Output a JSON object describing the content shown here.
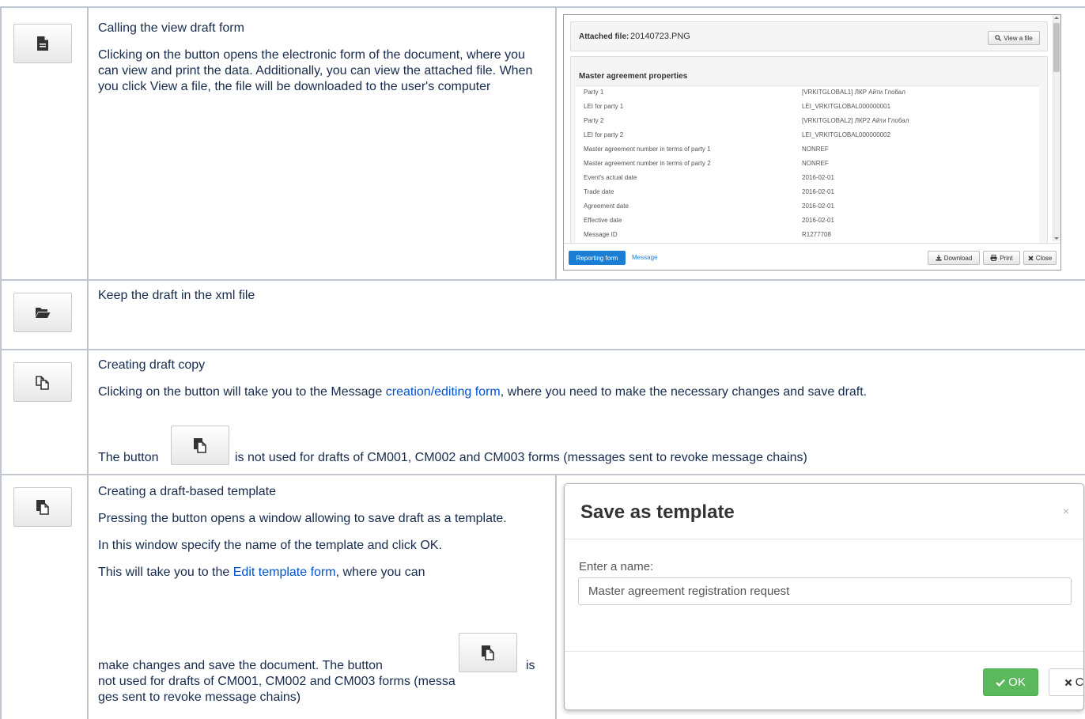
{
  "rows": [
    {
      "icon": "document-icon",
      "title": "Calling the view draft form",
      "body": "Clicking on the button opens the electronic form of the document, where you can view and print the data. Additionally, you can view the attached file. When you click View a file, the file will be downloaded to the user's computer"
    },
    {
      "icon": "folder-open-icon",
      "title": "Keep the draft in the xml file"
    },
    {
      "icon": "copy-icon",
      "title": "Creating draft copy",
      "body_prefix": "Clicking on the button will take you to the M",
      "body_prefix2": "essage ",
      "body_link": "creation/editing form",
      "body_suffix": ", where you need to make the necessary changes and save draft.",
      "note_prefix": "The button",
      "note_suffix": "is not used for drafts of CM001, CM002 and CM003 forms (",
      "note_suffix2": "messages",
      "note_suffix3": " sent to revoke message chains)"
    },
    {
      "icon": "paste-template-icon",
      "title": "Creating a draft-based template",
      "p1": "Pressing the button opens a window allowing to save draft as a template.",
      "p2": "In this window specify the name of the template and click OK.",
      "p3_prefix": "This will take you to the ",
      "p3_link": "Edit template form",
      "p3_suffix": ", where you can",
      "p4_prefix": "make changes and save the document. The button",
      "p4_is": "is",
      "p5": "not used for drafts of CM001, CM002 and CM003 forms (messa",
      "p6": "ges sent to revoke message chains)"
    }
  ],
  "view_form": {
    "attached_label": "Attached file:",
    "attached_value": "20140723.PNG",
    "view_file_btn": "View a file",
    "section_title": "Master agreement properties",
    "properties": [
      {
        "k": "Party 1",
        "v": "[VRKITGLOBAL1] ЛКР Айти Глобал"
      },
      {
        "k": "LEI for party 1",
        "v": "LEI_VRKITGLOBAL000000001"
      },
      {
        "k": "Party 2",
        "v": "[VRKITGLOBAL2] ЛКР2 Айти Глобал"
      },
      {
        "k": "LEI for party 2",
        "v": "LEI_VRKITGLOBAL000000002"
      },
      {
        "k": "Master agreement number in terms of party 1",
        "v": "NONREF"
      },
      {
        "k": "Master agreement number in terms of party 2",
        "v": "NONREF"
      },
      {
        "k": "Event's actual date",
        "v": "2016-02-01"
      },
      {
        "k": "Trade date",
        "v": "2016-02-01"
      },
      {
        "k": "Agreement date",
        "v": "2016-02-01"
      },
      {
        "k": "Effective date",
        "v": "2016-02-01"
      },
      {
        "k": "Message ID",
        "v": "R1277708"
      }
    ],
    "tab_reporting": "Reporting form",
    "tab_message": "Message",
    "download_btn": "Download",
    "print_btn": "Print",
    "close_btn": "Close"
  },
  "template_dialog": {
    "title": "Save as template",
    "close_glyph": "×",
    "label": "Enter a name:",
    "input_value": "Master agreement registration request",
    "ok": "OK",
    "cancel": "Cancel"
  },
  "colors": {
    "grid": "#c1c7d0",
    "link": "#0052cc",
    "primary": "#1a7fd4",
    "success": "#5cb85c"
  }
}
